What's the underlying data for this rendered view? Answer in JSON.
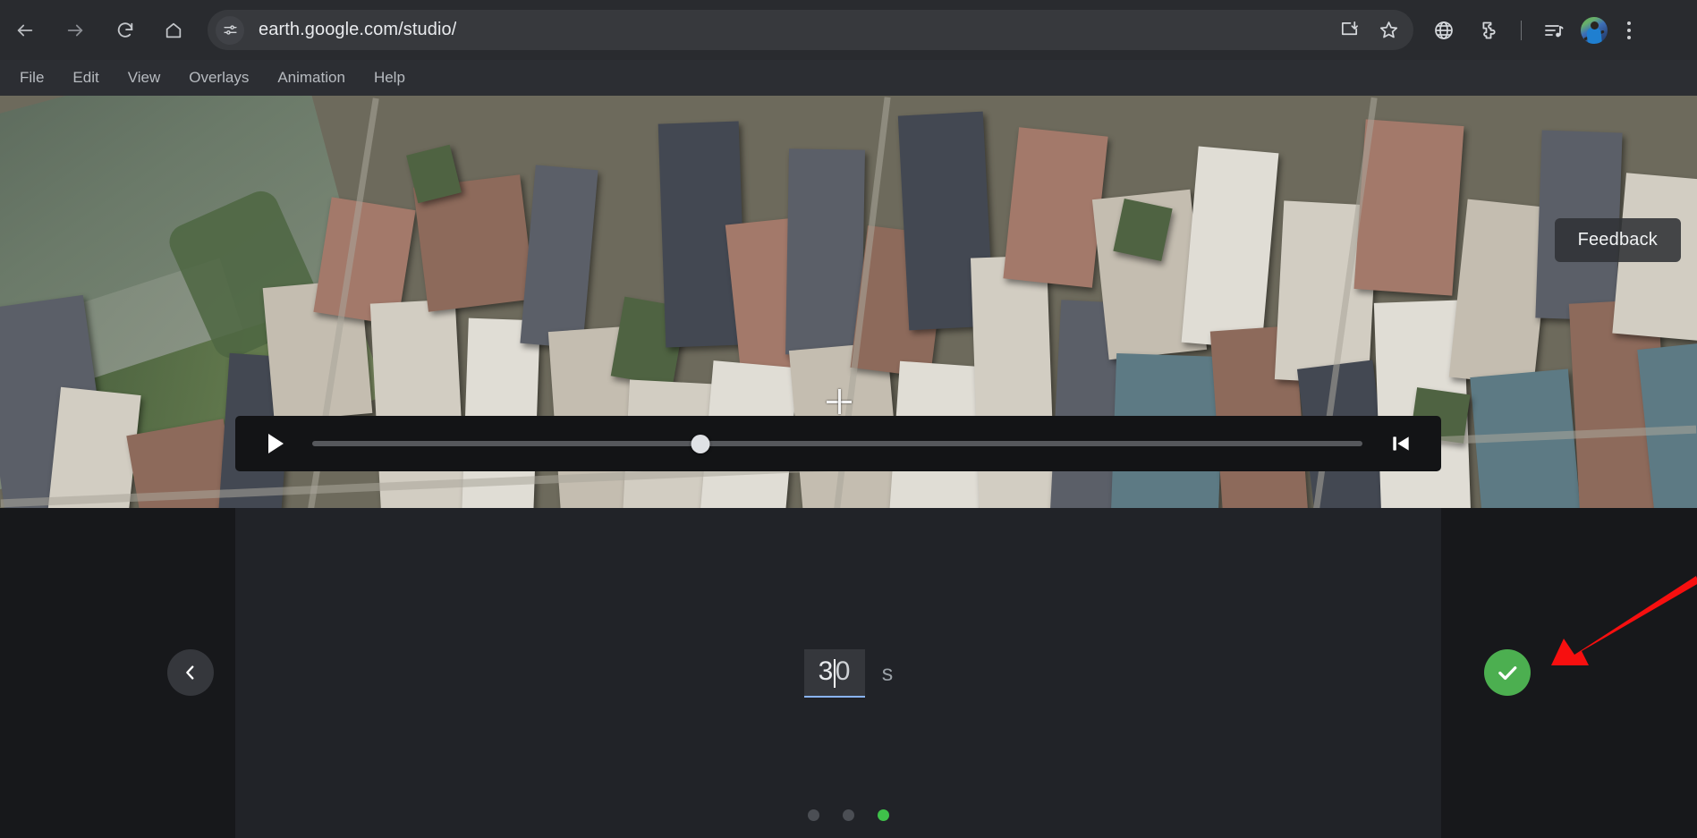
{
  "browser": {
    "url": "earth.google.com/studio/",
    "nav": {
      "back_label": "Back",
      "forward_label": "Forward",
      "reload_label": "Reload",
      "home_label": "Home"
    },
    "site_info_label": "View site information",
    "omnibox_actions": [
      {
        "name": "install-page-icon",
        "label": "Install page as app"
      },
      {
        "name": "bookmark-star-icon",
        "label": "Bookmark this tab"
      }
    ],
    "toolbar_actions": [
      {
        "name": "translate-globe-icon",
        "label": "Translate"
      },
      {
        "name": "extensions-puzzle-icon",
        "label": "Extensions"
      },
      {
        "name": "media-playlist-icon",
        "label": "Media controls"
      },
      {
        "name": "profile-avatar",
        "label": "Profile"
      },
      {
        "name": "chrome-menu-icon",
        "label": "Customize and control Chrome"
      }
    ]
  },
  "app": {
    "menubar": [
      {
        "label": "File"
      },
      {
        "label": "Edit"
      },
      {
        "label": "View"
      },
      {
        "label": "Overlays"
      },
      {
        "label": "Animation"
      },
      {
        "label": "Help"
      }
    ],
    "feedback_label": "Feedback"
  },
  "viewport": {
    "scene": "Aerial 3D view of Lower Manhattan, New York City",
    "crosshair_label": "Viewport center crosshair"
  },
  "playback": {
    "play_label": "Play",
    "skip_to_start_label": "Jump to start",
    "progress_percent": 37
  },
  "editor": {
    "prev_label": "Previous",
    "confirm_label": "Confirm",
    "duration": {
      "digit_before_caret": "3",
      "digit_after_caret": "0",
      "value": "30",
      "unit": "s"
    },
    "steps": [
      {
        "label": "Step 1",
        "active": false
      },
      {
        "label": "Step 2",
        "active": false
      },
      {
        "label": "Step 3",
        "active": true
      }
    ]
  },
  "annotation": {
    "arrow_color": "#f70f0f",
    "points_to": "confirm-button"
  },
  "colors": {
    "chrome_bg": "#292b2f",
    "menubar_bg": "#2c2e33",
    "panel_bg": "#212328",
    "outer_bg": "#17181b",
    "accent_blue": "#8ab4f8",
    "confirm_green": "#4caf50",
    "active_dot_green": "#3fc14a"
  }
}
